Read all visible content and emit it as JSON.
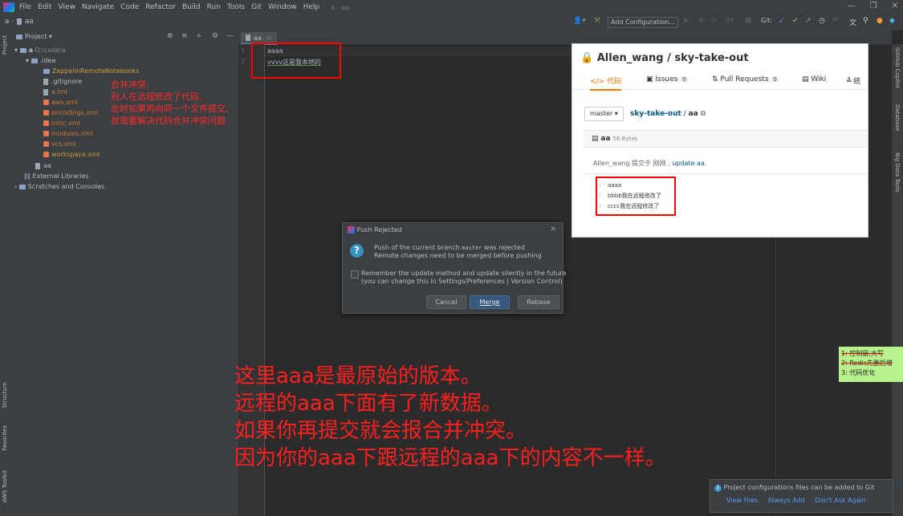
{
  "menu": [
    "File",
    "Edit",
    "View",
    "Navigate",
    "Code",
    "Refactor",
    "Build",
    "Run",
    "Tools",
    "Git",
    "Window",
    "Help"
  ],
  "window_title": "a - aa",
  "breadcrumb": {
    "project": "a",
    "file": "aa"
  },
  "toolbar": {
    "run_config": "Add Configuration...",
    "git_label": "Git:"
  },
  "project_panel": {
    "title": "Project",
    "tree": [
      {
        "label": "a",
        "path": "D:\\code\\a"
      },
      {
        "label": ".idea"
      },
      {
        "label": "ZeppelinRemoteNotebooks"
      },
      {
        "label": ".gitignore"
      },
      {
        "label": "a.iml"
      },
      {
        "label": "aws.xml"
      },
      {
        "label": "encodings.xml"
      },
      {
        "label": "misc.xml"
      },
      {
        "label": "modules.xml"
      },
      {
        "label": "vcs.xml"
      },
      {
        "label": "workspace.xml"
      },
      {
        "label": "aa"
      },
      {
        "label": "External Libraries"
      },
      {
        "label": "Scratches and Consoles"
      }
    ]
  },
  "left_tools": [
    "Project",
    "Structure",
    "Favorites",
    "AWS Toolkit"
  ],
  "right_tools": [
    "GitHub Copilot",
    "Database",
    "Big Data Tools"
  ],
  "editor": {
    "tab": "aa",
    "lines": [
      {
        "num": "1",
        "text": "aaaa"
      },
      {
        "num": "2",
        "text": "vvvv这是我本地的"
      }
    ]
  },
  "annotation_conflict": [
    "合并冲突:",
    "别人在远程修改了代码,",
    "此时如果再向同一个文件提交,",
    "就需要解决代码合并冲突问题"
  ],
  "dialog": {
    "title": "Push Rejected",
    "msg1_prefix": "Push of the current branch ",
    "branch": "master",
    "msg1_suffix": " was rejected",
    "msg2": "Remote changes need to be merged before pushing",
    "remember1": "Remember the update method and update silently in the future",
    "remember2": "(you can change this in Settings/Preferences | Version Control)",
    "cancel": "Cancel",
    "merge": "Merge",
    "rebase": "Rebase"
  },
  "gitee": {
    "repo": "Allen_wang / sky-take-out",
    "tabs": [
      {
        "label": "代码",
        "count": ""
      },
      {
        "label": "Issues",
        "count": "0"
      },
      {
        "label": "Pull Requests",
        "count": "0"
      },
      {
        "label": "Wiki",
        "count": ""
      },
      {
        "label": "统",
        "count": ""
      }
    ],
    "branch": "master",
    "path_repo": "sky-take-out",
    "path_file": "aa",
    "file_name": "aa",
    "file_size": "56 Bytes",
    "commit_prefix": "Allen_wang 提交于 刚刚 . ",
    "commit_msg": "update aa.",
    "lines": [
      {
        "num": "1",
        "text": "aaaa"
      },
      {
        "num": "2",
        "text": "bbbb我在远程修改了"
      },
      {
        "num": "3",
        "text": "cccc我在远程修改了"
      }
    ]
  },
  "big_annotation": [
    "这里aaa是最原始的版本。",
    "远程的aaa下面有了新数据。",
    "如果你再提交就会报合并冲突。",
    "因为你的aaa下跟远程的aaa下的内容不一样。"
  ],
  "sticky": [
    "1: 控制层,大写",
    "2: Redis先删后增",
    "3: 代码优化"
  ],
  "notification": {
    "text": "Project configurations files can be added to Git",
    "actions": [
      "View Files",
      "Always Add",
      "Don't Ask Again"
    ]
  }
}
